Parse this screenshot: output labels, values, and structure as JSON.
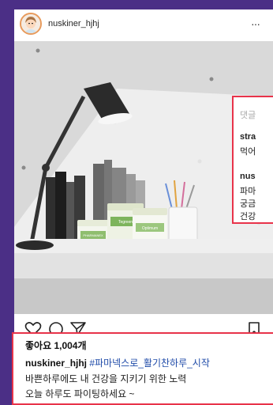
{
  "post": {
    "username": "nuskiner_hjhj",
    "more_label": "···"
  },
  "comments": {
    "header": "댓글",
    "c1_user": "stra",
    "c1_text": "먹어",
    "c2_user": "nus",
    "c2_line1": "파마",
    "c2_line2": "궁금",
    "c2_line3": "건강"
  },
  "product_labels": {
    "brand": "PHARMANEX",
    "jar1": "Reishi",
    "jar2": "Tegreen",
    "jar3": "Optimum"
  },
  "caption": {
    "likes": "좋아요 1,004개",
    "username": "nuskiner_hjhj",
    "hashtag": "#파마넥스로_활기찬하루_시작",
    "line2": "바쁜하루에도 내 건강을 지키기 위한 노력",
    "line3": "오늘 하루도 파이팅하세요 ~"
  },
  "colors": {
    "background": "#4b2f86",
    "highlight": "#e8334a",
    "hashtag": "#1e4aa8"
  },
  "icons": [
    "heart-icon",
    "comment-icon",
    "share-icon",
    "bookmark-icon",
    "more-icon"
  ]
}
